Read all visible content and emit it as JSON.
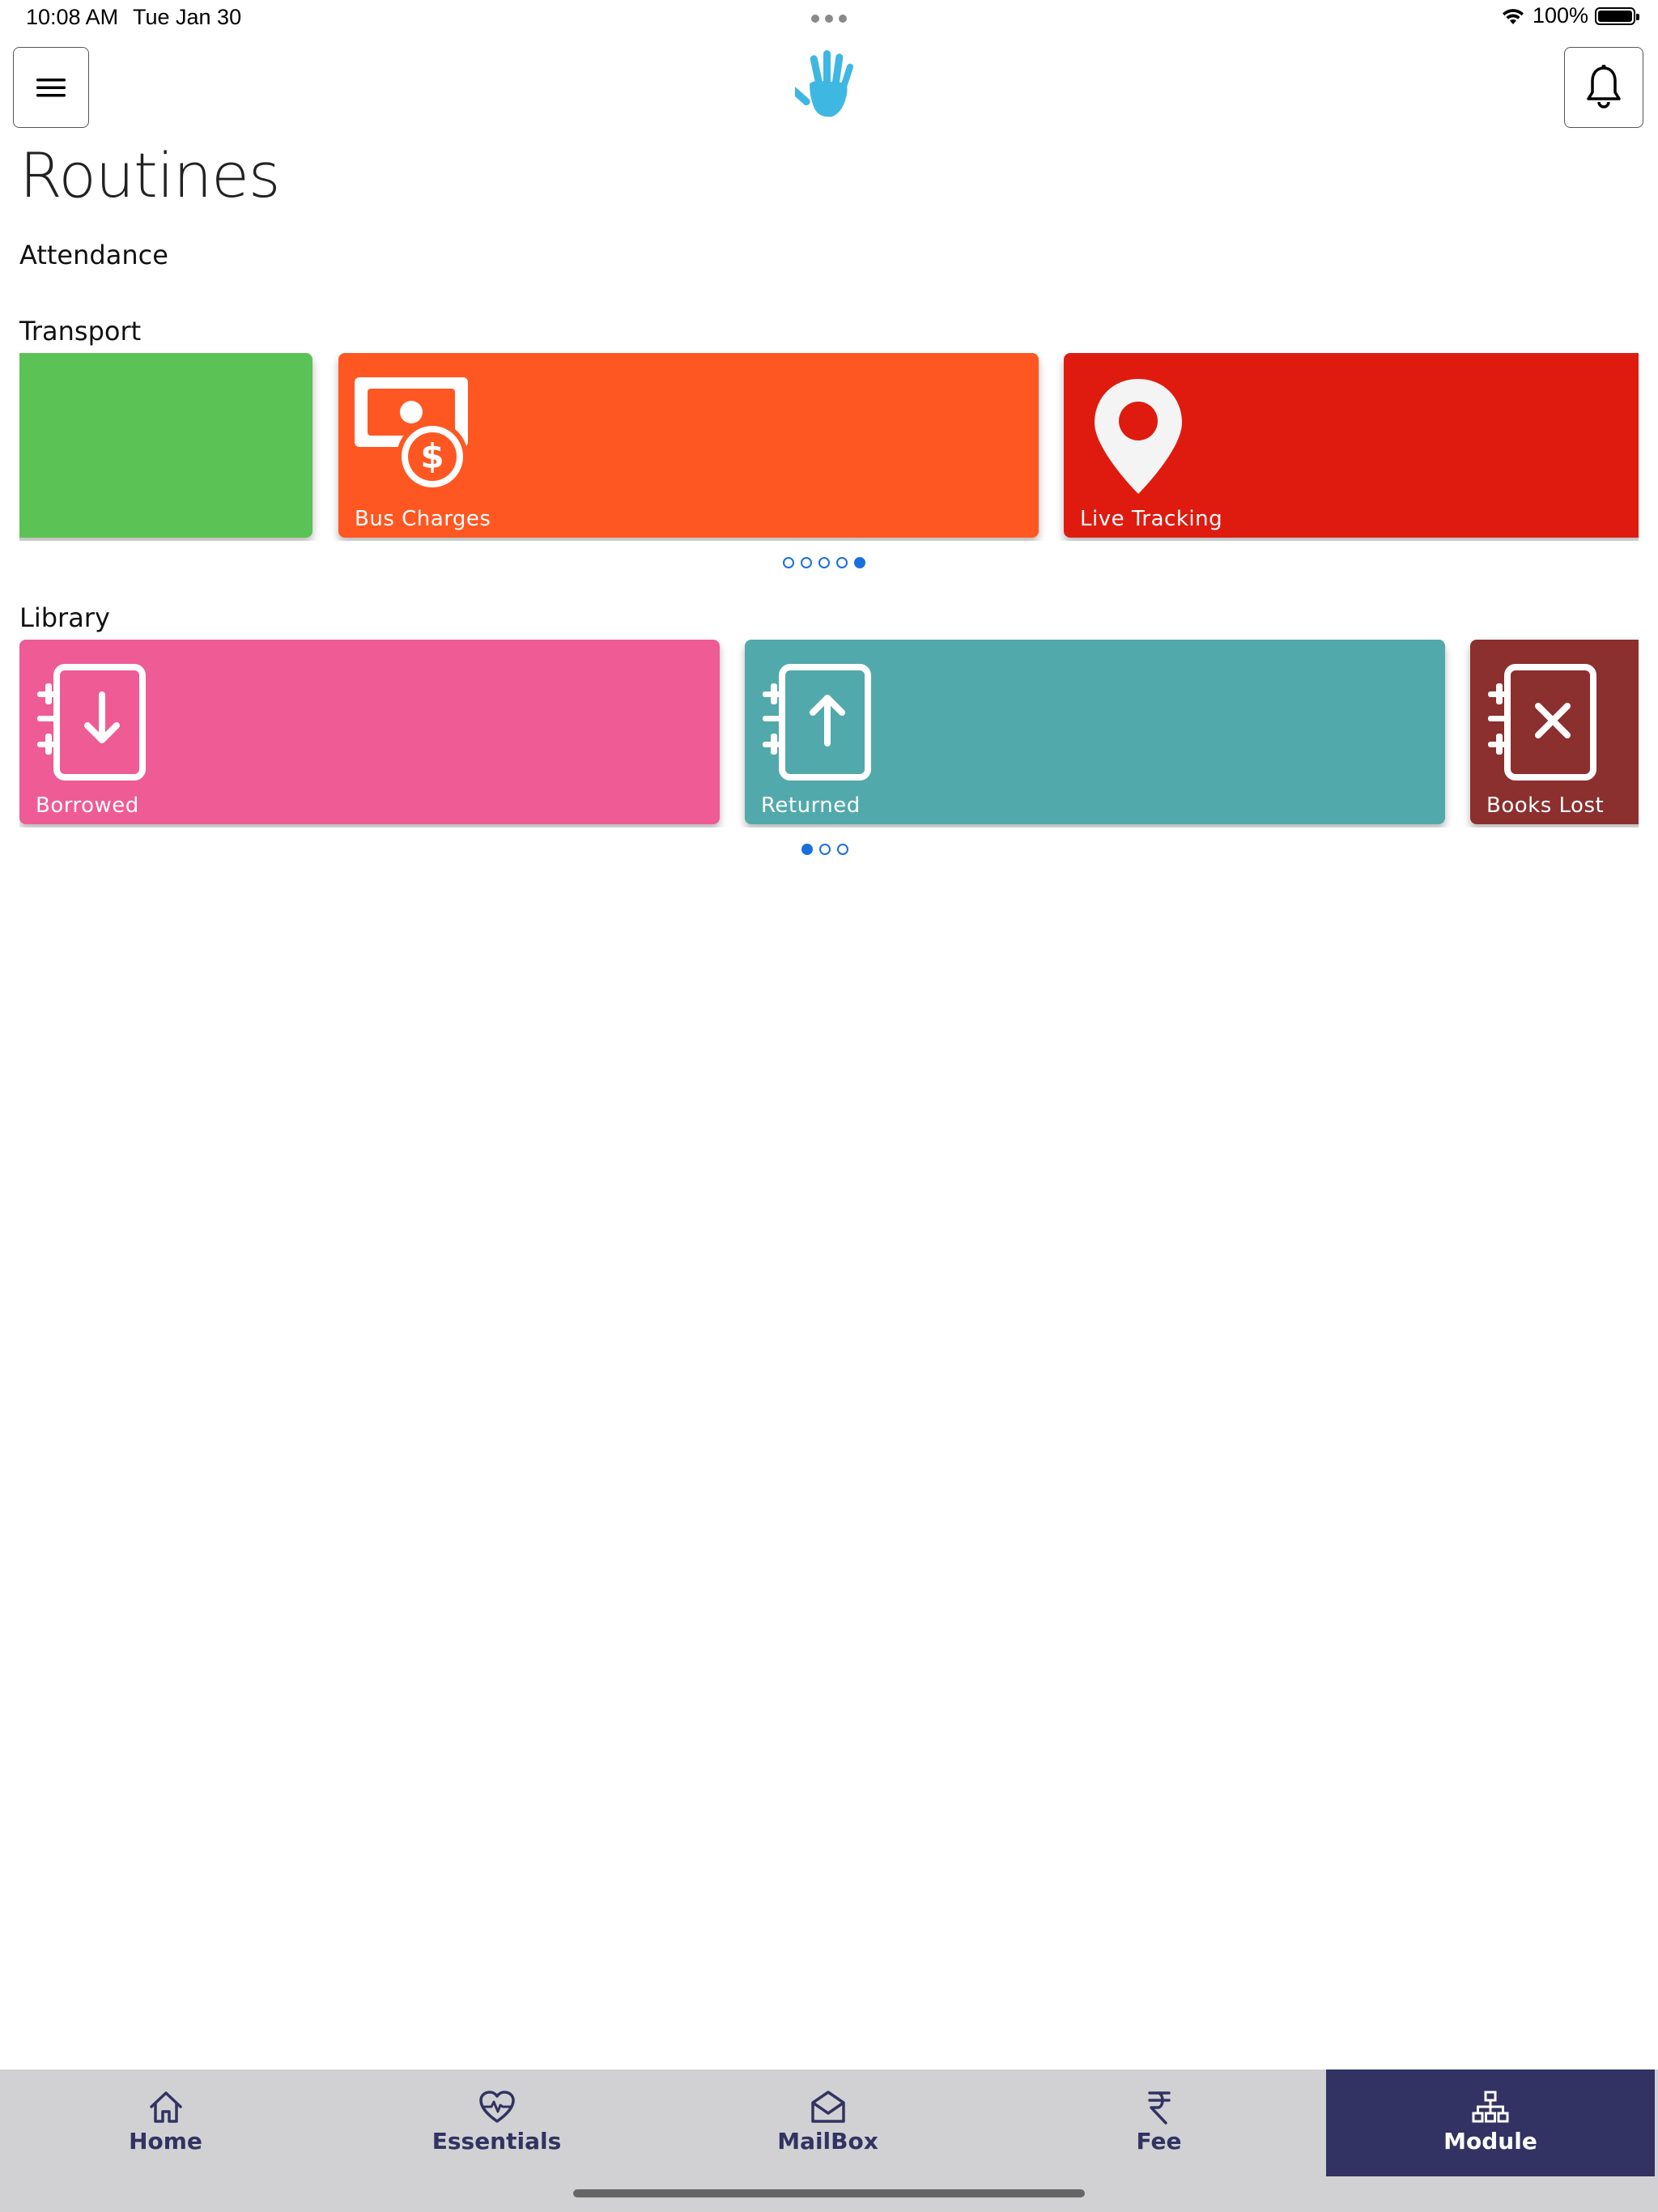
{
  "status": {
    "time": "10:08 AM",
    "date": "Tue Jan 30",
    "battery": "100%"
  },
  "header": {
    "menu_icon": "hamburger-menu-icon",
    "logo_icon": "hand-logo-icon",
    "bell_icon": "bell-icon",
    "logo_color": "#3fb7e3"
  },
  "page": {
    "title": "Routines"
  },
  "sections": {
    "attendance": {
      "title": "Attendance"
    },
    "transport": {
      "title": "Transport",
      "tiles": [
        {
          "label": "",
          "color": "#5bc255",
          "icon": ""
        },
        {
          "label": "Bus Charges",
          "color": "#ff5722",
          "icon": "money-dollar-icon"
        },
        {
          "label": "Live Tracking",
          "color": "#df1b0f",
          "icon": "location-pin-icon"
        }
      ],
      "page_count": 5,
      "active_page": 5
    },
    "library": {
      "title": "Library",
      "tiles": [
        {
          "label": "Borrowed",
          "color": "#ef5b95",
          "icon": "book-borrow-icon"
        },
        {
          "label": "Returned",
          "color": "#51a9ab",
          "icon": "book-return-icon"
        },
        {
          "label": "Books Lost",
          "color": "#8b2f2f",
          "icon": "book-lost-icon"
        }
      ],
      "page_count": 3,
      "active_page": 1
    }
  },
  "bottom_nav": {
    "items": [
      {
        "label": "Home",
        "icon": "home-icon"
      },
      {
        "label": "Essentials",
        "icon": "heart-pulse-icon"
      },
      {
        "label": "MailBox",
        "icon": "mailbox-icon"
      },
      {
        "label": "Fee",
        "icon": "rupee-icon"
      },
      {
        "label": "Module",
        "icon": "module-hierarchy-icon",
        "active": true
      }
    ],
    "active_color": "#323362",
    "background": "#d1d1d3"
  }
}
